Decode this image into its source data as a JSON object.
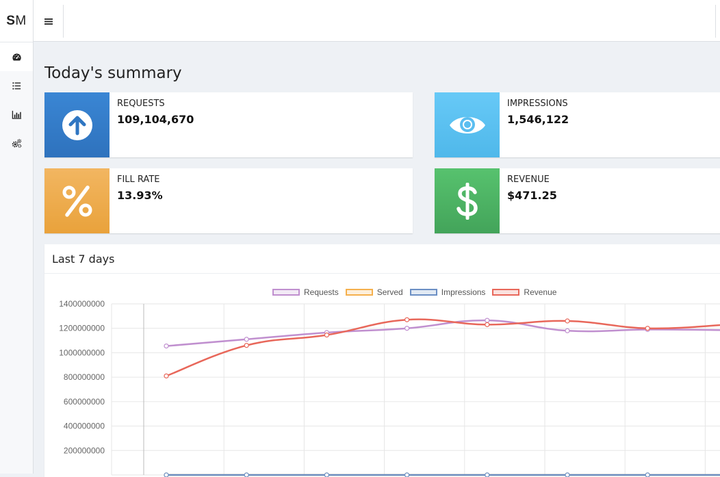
{
  "sidebar": {
    "logo_bold": "S",
    "logo_rest": "M",
    "items": [
      {
        "icon": "dashboard-gauge-icon",
        "active": true
      },
      {
        "icon": "list-icon",
        "active": false
      },
      {
        "icon": "bar-chart-icon",
        "active": false
      },
      {
        "icon": "gears-icon",
        "active": false
      }
    ]
  },
  "header": {
    "menu_icon": "hamburger-icon"
  },
  "main": {
    "title": "Today's summary",
    "cards": [
      {
        "label": "REQUESTS",
        "value": "109,104,670",
        "icon": "arrow-up-circle-icon",
        "color": "#3380cc"
      },
      {
        "label": "IMPRESSIONS",
        "value": "1,546,122",
        "icon": "eye-icon",
        "color": "#5cc0f1"
      },
      {
        "label": "FILL RATE",
        "value": "13.93%",
        "icon": "percent-icon",
        "color": "#eeac4f"
      },
      {
        "label": "REVENUE",
        "value": "$471.25",
        "icon": "dollar-icon",
        "color": "#4db564"
      }
    ],
    "panel_title": "Last 7 days"
  },
  "chart_data": {
    "type": "line",
    "legend_position": "top",
    "grid": true,
    "ylim": [
      0,
      1400000000
    ],
    "yticks": [
      "1400000000",
      "1200000000",
      "1000000000",
      "800000000",
      "600000000",
      "400000000",
      "200000000"
    ],
    "series": [
      {
        "name": "Requests",
        "color": "#c08fcf",
        "values": [
          1055000000,
          1110000000,
          1165000000,
          1200000000,
          1265000000,
          1180000000,
          1190000000,
          1185000000
        ]
      },
      {
        "name": "Served",
        "color": "#f5b04d",
        "values": [
          0,
          0,
          0,
          0,
          0,
          0,
          0,
          0
        ]
      },
      {
        "name": "Impressions",
        "color": "#6b8fc4",
        "values": [
          0,
          0,
          0,
          0,
          0,
          0,
          0,
          0
        ]
      },
      {
        "name": "Revenue",
        "color": "#e8675a",
        "values": [
          810000000,
          1060000000,
          1145000000,
          1270000000,
          1230000000,
          1260000000,
          1200000000,
          1230000000
        ]
      }
    ]
  }
}
